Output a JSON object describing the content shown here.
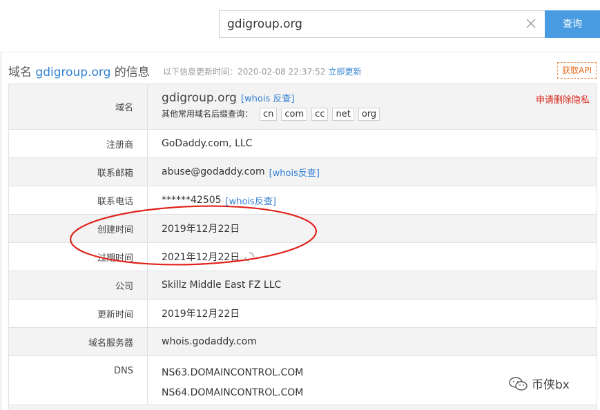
{
  "search": {
    "query": "gdigroup.org",
    "button_label": "查询"
  },
  "header": {
    "title_prefix": "域名",
    "title_domain": "gdigroup.org",
    "title_suffix": "的信息",
    "update_text": "以下信息更新时间：2020-02-08 22:37:52",
    "update_link": "立即更新",
    "api_button": "获取API"
  },
  "domain_row": {
    "label": "域名",
    "domain": "gdigroup.org",
    "whois_link": "[whois 反查]",
    "suffix_label": "其他常用域名后缀查询：",
    "suffixes": [
      "cn",
      "com",
      "cc",
      "net",
      "org"
    ],
    "privacy_link": "申请删除隐私"
  },
  "rows": [
    {
      "label": "注册商",
      "value": "GoDaddy.com, LLC"
    },
    {
      "label": "联系邮箱",
      "value": "abuse@godaddy.com",
      "link": "[whois反查]"
    },
    {
      "label": "联系电话",
      "value": "******42505",
      "link": "[whois反查]"
    },
    {
      "label": "创建时间",
      "value": "2019年12月22日"
    },
    {
      "label": "过期时间",
      "value": "2021年12月22日"
    },
    {
      "label": "公司",
      "value": "Skillz Middle East FZ LLC"
    },
    {
      "label": "更新时间",
      "value": "2019年12月22日"
    },
    {
      "label": "域名服务器",
      "value": "whois.godaddy.com"
    }
  ],
  "dns_row": {
    "label": "DNS",
    "servers": [
      "NS63.DOMAINCONTROL.COM",
      "NS64.DOMAINCONTROL.COM"
    ]
  },
  "watermark": {
    "text": "币侠bx"
  },
  "colors": {
    "accent": "#4a9ce2",
    "link": "#2f7fd2",
    "privacy": "#d9281d",
    "annotation": "#e0231b"
  }
}
